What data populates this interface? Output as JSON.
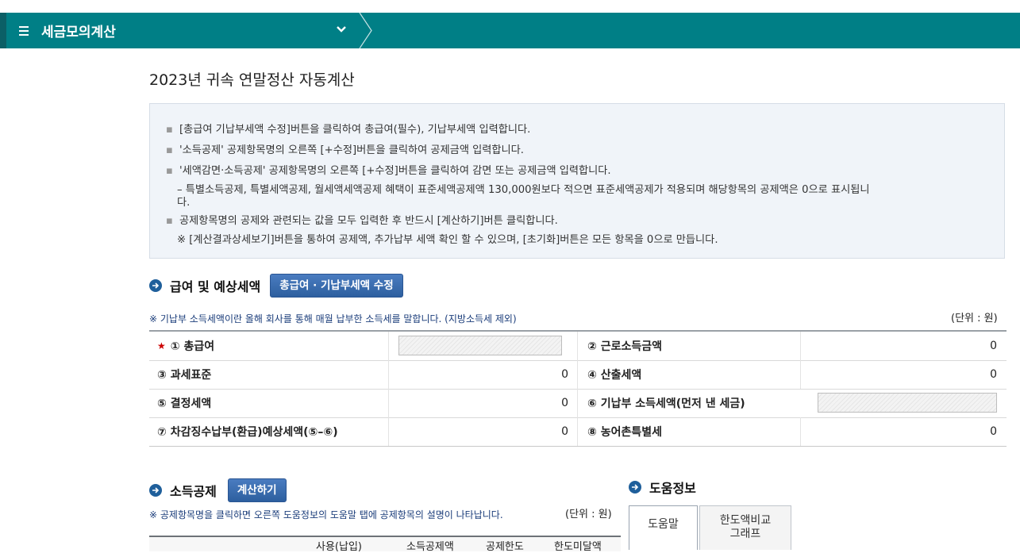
{
  "topbar": {
    "menu_title": "세금모의계산"
  },
  "page_title": "2023년 귀속 연말정산 자동계산",
  "notice": {
    "lines": [
      "[총급여 기납부세액 수정]버튼을 클릭하여 총급여(필수), 기납부세액 입력합니다.",
      "'소득공제' 공제항목명의 오른쪽 [+수정]버튼을 클릭하여 공제금액 입력합니다.",
      "'세액감면·소득공제' 공제항목명의 오른쪽 [+수정]버튼을 클릭하여 감면 또는 공제금액 입력합니다.",
      "– 특별소득공제, 특별세액공제, 월세액세액공제 혜택이 표준세액공제액 130,000원보다 적으면 표준세액공제가 적용되며 해당항목의 공제액은 0으로 표시됩니",
      "다.",
      "공제항목명의 공제와 관련되는 값을 모두 입력한 후 반드시 [계산하기]버튼 클릭합니다.",
      "※ [계산결과상세보기]버튼을 통하여 공제액, 추가납부 세액 확인 할 수 있으며, [초기화]버튼은 모든 항목을 0으로 만듭니다."
    ]
  },
  "salary_section": {
    "title": "급여 및 예상세액",
    "button": "총급여 · 기납부세액 수정",
    "note": "※ 기납부 소득세액이란 올해 회사를 통해 매월 납부한 소득세를 말합니다. (지방소득세 제외)",
    "unit": "(단위 : 원)",
    "rows": [
      {
        "left_label": "① 총급여",
        "left_value": "",
        "right_label": "② 근로소득금액",
        "right_value": "0"
      },
      {
        "left_label": "③ 과세표준",
        "left_value": "0",
        "right_label": "④ 산출세액",
        "right_value": "0"
      },
      {
        "left_label": "⑤ 결정세액",
        "left_value": "0",
        "right_label": "⑥ 기납부 소득세액(먼저 낸 세금)",
        "right_value": ""
      },
      {
        "left_label": "⑦ 차감징수납부(환급)예상세액(⑤–⑥)",
        "left_value": "0",
        "right_label": "⑧ 농어촌특별세",
        "right_value": "0"
      }
    ]
  },
  "deduction_section": {
    "title": "소득공제",
    "button": "계산하기",
    "note": "※ 공제항목명을 클릭하면 오른쪽 도움정보의 도움말 탭에 공제항목의 설명이 나타납니다.",
    "unit": "(단위 : 원)",
    "columns": [
      "사용(납입)",
      "소득공제액",
      "공제한도",
      "한도미달액"
    ]
  },
  "help_section": {
    "title": "도움정보",
    "tabs": [
      "도움말",
      "한도액비교",
      "그래프"
    ]
  },
  "colors": {
    "topbar": "#007f86",
    "button": "#2d5f9f",
    "section_icon": "#1f5f9b"
  }
}
